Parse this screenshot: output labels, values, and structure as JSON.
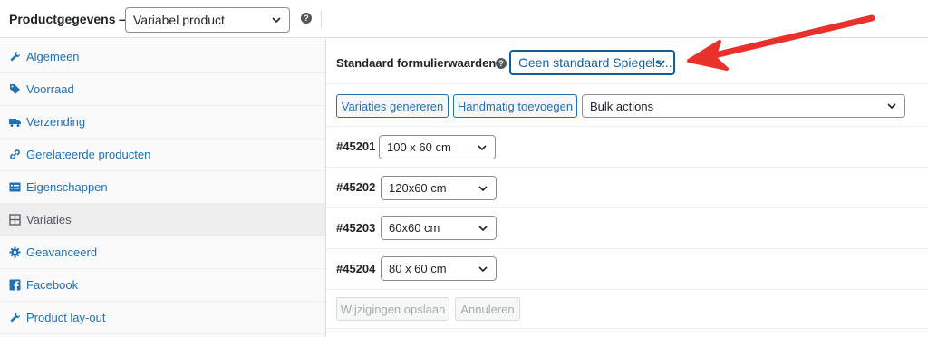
{
  "header": {
    "title": "Productgegevens —",
    "product_type": "Variabel product"
  },
  "sidebar": {
    "items": [
      {
        "label": "Algemeen",
        "icon": "wrench-icon"
      },
      {
        "label": "Voorraad",
        "icon": "tag-icon"
      },
      {
        "label": "Verzending",
        "icon": "truck-icon"
      },
      {
        "label": "Gerelateerde producten",
        "icon": "link-icon"
      },
      {
        "label": "Eigenschappen",
        "icon": "list-table-icon"
      },
      {
        "label": "Variaties",
        "icon": "grid-icon",
        "active": true
      },
      {
        "label": "Geavanceerd",
        "icon": "gear-icon"
      },
      {
        "label": "Facebook",
        "icon": "facebook-icon"
      },
      {
        "label": "Product lay-out",
        "icon": "wrench-icon"
      }
    ]
  },
  "defaults": {
    "label": "Standaard formulierwaarden:",
    "value": "Geen standaard Spiegels..."
  },
  "toolbar": {
    "generate": "Variaties genereren",
    "add_manual": "Handmatig toevoegen",
    "bulk": "Bulk actions"
  },
  "variations": [
    {
      "id": "#45201",
      "value": "100 x 60 cm"
    },
    {
      "id": "#45202",
      "value": "120x60 cm"
    },
    {
      "id": "#45203",
      "value": "60x60 cm"
    },
    {
      "id": "#45204",
      "value": "80 x 60 cm"
    }
  ],
  "footer": {
    "save": "Wijzigingen opslaan",
    "cancel": "Annuleren"
  },
  "colors": {
    "link": "#2271b1",
    "annotation_arrow": "#e8312a"
  }
}
